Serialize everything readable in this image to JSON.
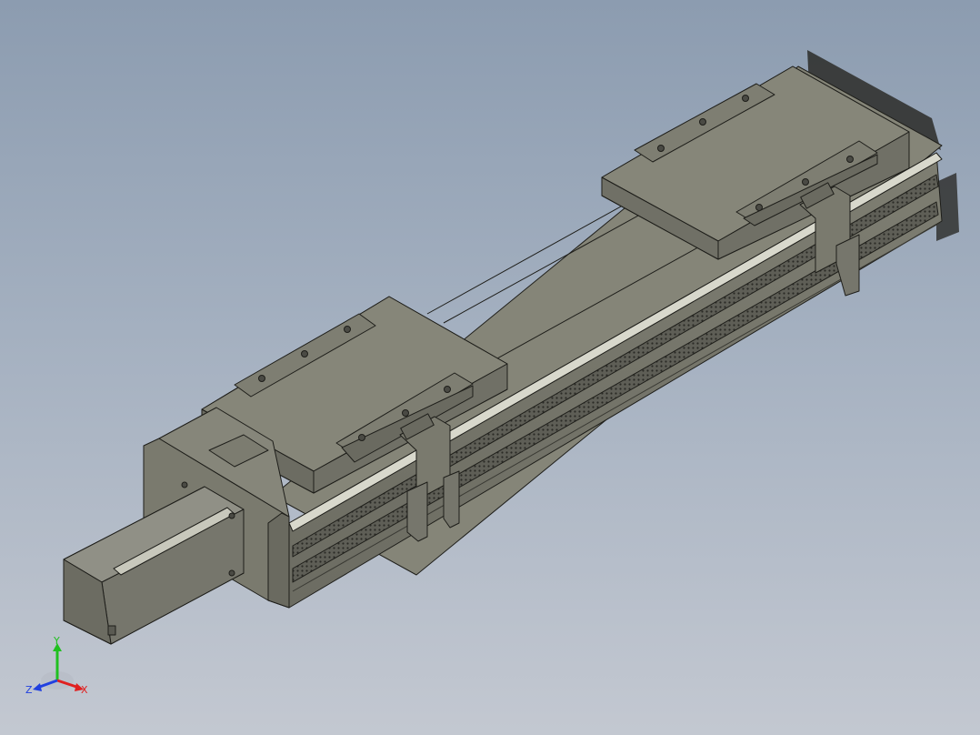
{
  "viewport": {
    "background_top": "#8c9cb0",
    "background_bottom": "#c3c8d1"
  },
  "model": {
    "body_color": "#8a8a7e",
    "top_color": "#858578",
    "dark_color": "#6a6a60",
    "edge_color": "#1e1e1a",
    "highlight_color": "#e8e8dc"
  },
  "triad": {
    "x_label": "X",
    "y_label": "Y",
    "z_label": "Z",
    "x_color": "#e02020",
    "y_color": "#20c020",
    "z_color": "#2040e0"
  }
}
